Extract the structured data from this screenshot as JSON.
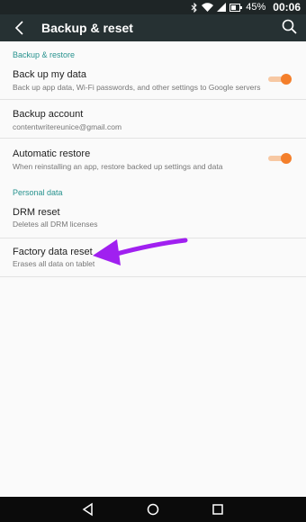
{
  "status_bar": {
    "battery_percent": "45%",
    "time": "00:06",
    "icons": [
      "bluetooth-icon",
      "wifi-icon",
      "signal-icon",
      "battery-icon"
    ]
  },
  "app_bar": {
    "title": "Backup & reset",
    "back_icon": "back-arrow-icon",
    "search_icon": "search-icon"
  },
  "sections": {
    "backup_restore": {
      "header": "Backup & restore",
      "back_up_my_data": {
        "title": "Back up my data",
        "subtitle": "Back up app data, Wi-Fi passwords, and other settings to Google servers",
        "toggle": "on"
      },
      "backup_account": {
        "title": "Backup account",
        "subtitle": "contentwritereunice@gmail.com"
      },
      "automatic_restore": {
        "title": "Automatic restore",
        "subtitle": "When reinstalling an app, restore backed up settings and data",
        "toggle": "on"
      }
    },
    "personal_data": {
      "header": "Personal data",
      "drm_reset": {
        "title": "DRM reset",
        "subtitle": "Deletes all DRM licenses"
      },
      "factory_data_reset": {
        "title": "Factory data reset",
        "subtitle": "Erases all data on tablet"
      }
    }
  },
  "nav_bar": {
    "icons": [
      "nav-back-icon",
      "nav-home-icon",
      "nav-recents-icon"
    ]
  },
  "colors": {
    "accent": "#27928e",
    "toggle_on": "#f47f2b",
    "annotation_arrow": "#a020f0"
  }
}
